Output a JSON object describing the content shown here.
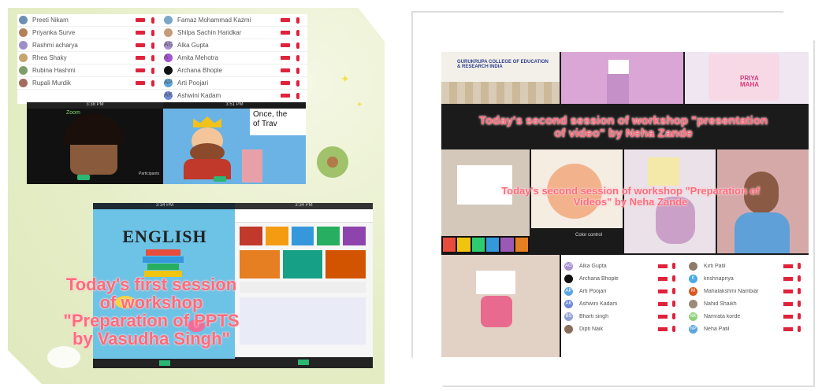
{
  "left_collage": {
    "participants_left": [
      {
        "name": "Preeti Nikam",
        "color": "#6d8fb3"
      },
      {
        "name": "Priyanka Surve",
        "color": "#b67f5a"
      },
      {
        "name": "Rashmi acharya",
        "color": "#9e8fc9"
      },
      {
        "name": "Rhea Shaky",
        "color": "#c7a36e"
      },
      {
        "name": "Rubina Hashmi",
        "color": "#7f9c6a"
      },
      {
        "name": "Rupali Murdik",
        "color": "#a66b5b"
      }
    ],
    "participants_right": [
      {
        "name": "Famaz Mohammad Kazmi",
        "initials": "",
        "color": "#7aa7c9"
      },
      {
        "name": "Shilpa Sachin Haridkar",
        "initials": "",
        "color": "#c69b7b"
      },
      {
        "name": "Alka Gupta",
        "initials": "AG",
        "color": "#a58fd1"
      },
      {
        "name": "Amita Mehotra",
        "initials": "A",
        "color": "#a352d1"
      },
      {
        "name": "Archana Bhople",
        "initials": "",
        "color": "#111111"
      },
      {
        "name": "Arti Poojari",
        "initials": "AP",
        "color": "#5aa6df"
      },
      {
        "name": "Ashwini Kadam",
        "initials": "AK",
        "color": "#6d8ad8"
      }
    ],
    "zoom_label": "Zoom",
    "participants_label": "Participants",
    "video_text": "Once, the\nof Trav",
    "english_title": "ENGLISH",
    "overlay_text": "Today's first session\nof workshop\n\"Preparation of PPTS\nby Vasudha Singh\""
  },
  "right_collage": {
    "school_text": "GURUKRUPA COLLEGE OF EDUCATION & RESEARCH INDIA",
    "priya_text": "PRIYA\nMAHA",
    "overlay_top": "Today's second session of workshop \"presentation\nof video\" by Neha Zande",
    "overlay_mid": "Today's second session of workshop \"Preparation of\nVideos\" by Neha Zande",
    "color_control": "Color control",
    "participants_left": [
      {
        "name": "Alka Gupta",
        "initials": "AG",
        "color": "#a58fd1"
      },
      {
        "name": "Archana Bhople",
        "initials": "",
        "color": "#111111"
      },
      {
        "name": "Arti Poojari",
        "initials": "AP",
        "color": "#5aa6df"
      },
      {
        "name": "Ashwini Kadam",
        "initials": "AK",
        "color": "#6d8ad8"
      },
      {
        "name": "Bharti singh",
        "initials": "BS",
        "color": "#8fa0d4"
      },
      {
        "name": "Dipti Naik",
        "initials": "",
        "color": "#8a6d5c"
      }
    ],
    "participants_right": [
      {
        "name": "Kirti Patil",
        "initials": "",
        "color": "#8d7a6a"
      },
      {
        "name": "krishnapriya",
        "initials": "K",
        "color": "#4aa9e6"
      },
      {
        "name": "Mahalakshmi Nambiar",
        "initials": "M",
        "color": "#d9571e"
      },
      {
        "name": "Nahid Shaikh",
        "initials": "",
        "color": "#9b8a77"
      },
      {
        "name": "Namrata korde",
        "initials": "NK",
        "color": "#8fd17a"
      },
      {
        "name": "Neha Patil",
        "initials": "NP",
        "color": "#5aa6df"
      }
    ]
  }
}
